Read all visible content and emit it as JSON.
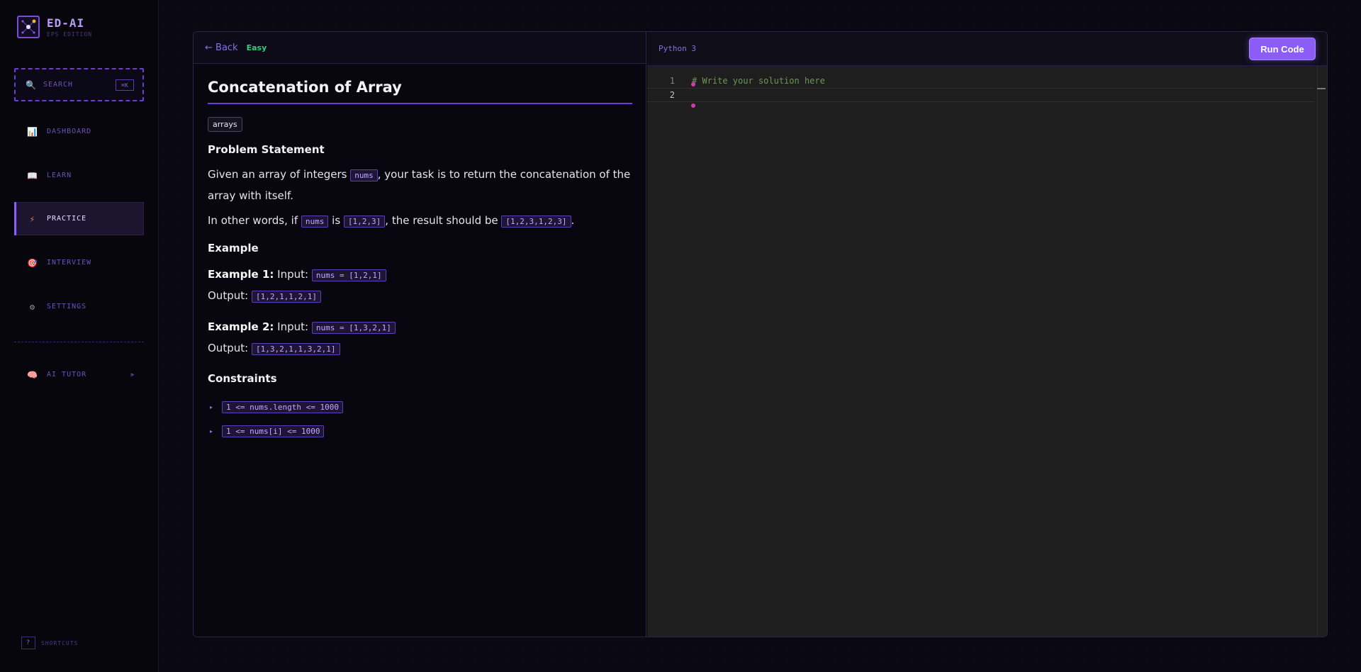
{
  "brand": {
    "name": "ED-AI",
    "subtitle": "EPS EDITION"
  },
  "search": {
    "label": "SEARCH",
    "shortcut": "⌘K"
  },
  "nav": [
    {
      "label": "DASHBOARD",
      "icon": "chart-icon"
    },
    {
      "label": "LEARN",
      "icon": "book-icon"
    },
    {
      "label": "PRACTICE",
      "icon": "lightning-icon",
      "active": true
    },
    {
      "label": "INTERVIEW",
      "icon": "target-icon"
    },
    {
      "label": "SETTINGS",
      "icon": "gear-icon"
    }
  ],
  "ai_tutor": {
    "label": "AI TUTOR",
    "arrow": "▶"
  },
  "shortcuts": {
    "label": "SHORTCUTS",
    "key": "?"
  },
  "problem": {
    "back_label": "← Back",
    "difficulty": "Easy",
    "title": "Concatenation of Array",
    "tag": "arrays",
    "statement_heading": "Problem Statement",
    "statement_p1_a": "Given an array of integers",
    "statement_p1_code": "nums",
    "statement_p1_b": ", your task is to return the concatenation of the array with itself.",
    "statement_p2_a": "In other words, if",
    "statement_p2_code1": "nums",
    "statement_p2_b": "is",
    "statement_p2_code2": "[1,2,3]",
    "statement_p2_c": ", the result should be",
    "statement_p2_code3": "[1,2,3,1,2,3]",
    "statement_p2_d": ".",
    "example_heading": "Example",
    "examples": [
      {
        "label": "Example 1:",
        "input_label": "Input:",
        "input": "nums = [1,2,1]",
        "output_label": "Output:",
        "output": "[1,2,1,1,2,1]"
      },
      {
        "label": "Example 2:",
        "input_label": "Input:",
        "input": "nums = [1,3,2,1]",
        "output_label": "Output:",
        "output": "[1,3,2,1,1,3,2,1]"
      }
    ],
    "constraints_heading": "Constraints",
    "constraints": [
      "1 <= nums.length <= 1000",
      "1 <= nums[i] <= 1000"
    ]
  },
  "editor": {
    "language": "Python 3",
    "run_label": "Run Code",
    "lines": [
      {
        "number": "1",
        "text": "# Write your solution here"
      },
      {
        "number": "2",
        "text": ""
      }
    ]
  },
  "colors": {
    "accent": "#8b5cf6",
    "easy": "#2fce7a",
    "comment": "#6a9955",
    "cursor": "#d63aa8"
  }
}
